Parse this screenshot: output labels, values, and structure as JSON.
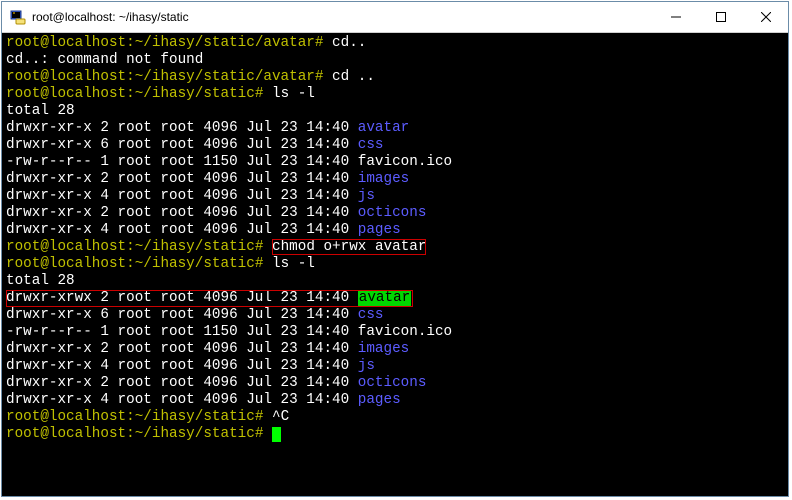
{
  "window": {
    "title": "root@localhost: ~/ihasy/static"
  },
  "term": {
    "prompt_user": "root@localhost",
    "prompt_path_avatar": ":~/ihasy/static/avatar#",
    "prompt_path_static": ":~/ihasy/static#",
    "cmd_cd_bad": " cd..",
    "err_cd": "cd..: command not found",
    "cmd_cd_ok": " cd ..",
    "cmd_ls": " ls -l",
    "total": "total 28",
    "ls1": [
      {
        "perm": "drwxr-xr-x",
        "n": "2",
        "own": "root root",
        "sz": "4096",
        "dt": "Jul 23 14:40",
        "name": "avatar",
        "dir": true
      },
      {
        "perm": "drwxr-xr-x",
        "n": "6",
        "own": "root root",
        "sz": "4096",
        "dt": "Jul 23 14:40",
        "name": "css",
        "dir": true
      },
      {
        "perm": "-rw-r--r--",
        "n": "1",
        "own": "root root",
        "sz": "1150",
        "dt": "Jul 23 14:40",
        "name": "favicon.ico",
        "dir": false
      },
      {
        "perm": "drwxr-xr-x",
        "n": "2",
        "own": "root root",
        "sz": "4096",
        "dt": "Jul 23 14:40",
        "name": "images",
        "dir": true
      },
      {
        "perm": "drwxr-xr-x",
        "n": "4",
        "own": "root root",
        "sz": "4096",
        "dt": "Jul 23 14:40",
        "name": "js",
        "dir": true
      },
      {
        "perm": "drwxr-xr-x",
        "n": "2",
        "own": "root root",
        "sz": "4096",
        "dt": "Jul 23 14:40",
        "name": "octicons",
        "dir": true
      },
      {
        "perm": "drwxr-xr-x",
        "n": "4",
        "own": "root root",
        "sz": "4096",
        "dt": "Jul 23 14:40",
        "name": "pages",
        "dir": true
      }
    ],
    "cmd_chmod_pre": " ",
    "cmd_chmod": "chmod o+rwx avatar",
    "ls2": [
      {
        "perm": "drwxr-xrwx",
        "n": "2",
        "own": "root root",
        "sz": "4096",
        "dt": "Jul 23 14:40",
        "name": "avatar",
        "dir": true,
        "hl": true
      },
      {
        "perm": "drwxr-xr-x",
        "n": "6",
        "own": "root root",
        "sz": "4096",
        "dt": "Jul 23 14:40",
        "name": "css",
        "dir": true
      },
      {
        "perm": "-rw-r--r--",
        "n": "1",
        "own": "root root",
        "sz": "1150",
        "dt": "Jul 23 14:40",
        "name": "favicon.ico",
        "dir": false
      },
      {
        "perm": "drwxr-xr-x",
        "n": "2",
        "own": "root root",
        "sz": "4096",
        "dt": "Jul 23 14:40",
        "name": "images",
        "dir": true
      },
      {
        "perm": "drwxr-xr-x",
        "n": "4",
        "own": "root root",
        "sz": "4096",
        "dt": "Jul 23 14:40",
        "name": "js",
        "dir": true
      },
      {
        "perm": "drwxr-xr-x",
        "n": "2",
        "own": "root root",
        "sz": "4096",
        "dt": "Jul 23 14:40",
        "name": "octicons",
        "dir": true
      },
      {
        "perm": "drwxr-xr-x",
        "n": "4",
        "own": "root root",
        "sz": "4096",
        "dt": "Jul 23 14:40",
        "name": "pages",
        "dir": true
      }
    ],
    "cmd_ctrlc": " ^C",
    "cmd_blank": " "
  }
}
